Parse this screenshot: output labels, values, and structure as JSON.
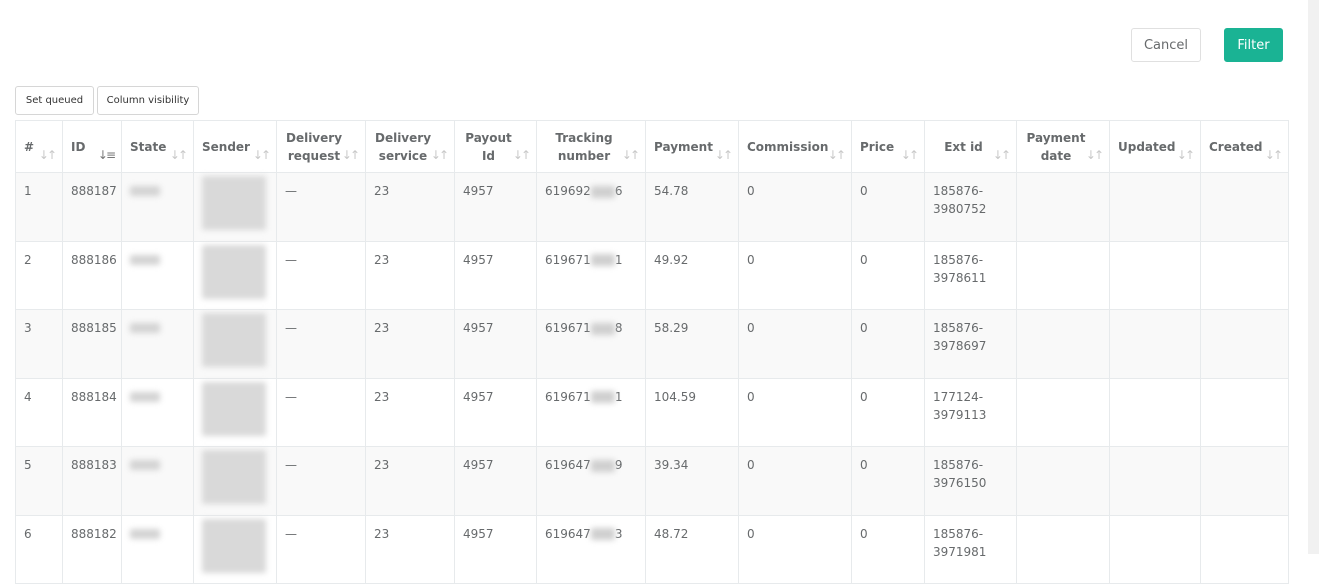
{
  "actions": {
    "cancel": "Cancel",
    "filter": "Filter",
    "set_queued": "Set queued",
    "column_visibility": "Column visibility"
  },
  "table": {
    "headers": [
      {
        "key": "num",
        "label": "#"
      },
      {
        "key": "id",
        "label": "ID"
      },
      {
        "key": "state",
        "label": "State"
      },
      {
        "key": "sender",
        "label": "Sender"
      },
      {
        "key": "delivery_request",
        "label": "Delivery request"
      },
      {
        "key": "delivery_service",
        "label": "Delivery service"
      },
      {
        "key": "payout_id",
        "label": "Payout Id"
      },
      {
        "key": "tracking_number",
        "label": "Tracking number"
      },
      {
        "key": "payment",
        "label": "Payment"
      },
      {
        "key": "commission",
        "label": "Commission"
      },
      {
        "key": "price",
        "label": "Price"
      },
      {
        "key": "ext_id",
        "label": "Ext id"
      },
      {
        "key": "payment_date",
        "label": "Payment date"
      },
      {
        "key": "updated",
        "label": "Updated"
      },
      {
        "key": "created",
        "label": "Created"
      }
    ],
    "sorted_column": "ID",
    "rows": [
      {
        "num": "1",
        "id": "888187",
        "delivery_request": "—",
        "delivery_service": "23",
        "payout_id": "4957",
        "tracking_prefix": "619692",
        "tracking_suffix": "6",
        "payment": "54.78",
        "commission": "0",
        "price": "0",
        "ext_id": "185876-3980752",
        "payment_date": "",
        "updated": "",
        "created": ""
      },
      {
        "num": "2",
        "id": "888186",
        "delivery_request": "—",
        "delivery_service": "23",
        "payout_id": "4957",
        "tracking_prefix": "619671",
        "tracking_suffix": "1",
        "payment": "49.92",
        "commission": "0",
        "price": "0",
        "ext_id": "185876-3978611",
        "payment_date": "",
        "updated": "",
        "created": ""
      },
      {
        "num": "3",
        "id": "888185",
        "delivery_request": "—",
        "delivery_service": "23",
        "payout_id": "4957",
        "tracking_prefix": "619671",
        "tracking_suffix": "8",
        "payment": "58.29",
        "commission": "0",
        "price": "0",
        "ext_id": "185876-3978697",
        "payment_date": "",
        "updated": "",
        "created": ""
      },
      {
        "num": "4",
        "id": "888184",
        "delivery_request": "—",
        "delivery_service": "23",
        "payout_id": "4957",
        "tracking_prefix": "619671",
        "tracking_suffix": "1",
        "payment": "104.59",
        "commission": "0",
        "price": "0",
        "ext_id": "177124-3979113",
        "payment_date": "",
        "updated": "",
        "created": ""
      },
      {
        "num": "5",
        "id": "888183",
        "delivery_request": "—",
        "delivery_service": "23",
        "payout_id": "4957",
        "tracking_prefix": "619647",
        "tracking_suffix": "9",
        "payment": "39.34",
        "commission": "0",
        "price": "0",
        "ext_id": "185876-3976150",
        "payment_date": "",
        "updated": "",
        "created": ""
      },
      {
        "num": "6",
        "id": "888182",
        "delivery_request": "—",
        "delivery_service": "23",
        "payout_id": "4957",
        "tracking_prefix": "619647",
        "tracking_suffix": "3",
        "payment": "48.72",
        "commission": "0",
        "price": "0",
        "ext_id": "185876-3971981",
        "payment_date": "",
        "updated": "",
        "created": ""
      }
    ]
  },
  "colors": {
    "primary": "#1ab394",
    "border": "#e7eaec",
    "text": "#676a6c",
    "stripe": "#f9f9f9"
  },
  "icons": {
    "sort": "sort-both-icon",
    "sort_active": "sort-desc-icon"
  }
}
